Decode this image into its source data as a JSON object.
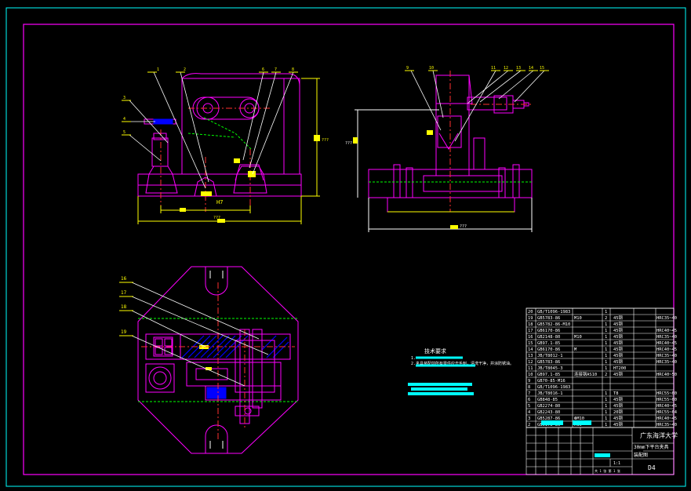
{
  "colors": {
    "background": "#000000",
    "outer_frame": "#00ffff",
    "drawing_border": "#ff00ff",
    "part_outline": "#ff00ff",
    "dimension": "#ffff00",
    "centerline": "#ff3030",
    "hidden_line": "#00ff00",
    "leader": "#ffffff",
    "hatch": "#0000ff",
    "title_text": "#ffffff",
    "highlight": "#00ffff"
  },
  "front_view": {
    "callouts": [
      "1",
      "2",
      "3",
      "4",
      "5",
      "6",
      "7",
      "8"
    ],
    "dim_width": "???",
    "dim_height": "???",
    "dim_fit": "H7"
  },
  "side_view": {
    "callouts": [
      "9",
      "10",
      "11",
      "12",
      "13",
      "14",
      "15"
    ],
    "dim_width": "???",
    "dim_height": "???"
  },
  "top_view": {
    "callouts": [
      "16",
      "17",
      "18",
      "19"
    ]
  },
  "tech_requirements": {
    "title": "技术要求",
    "line1": "1.",
    "line2": "2.夹具装配前所有零件应去毛刺，清洗干净，并涂防锈油。"
  },
  "parts_list": {
    "rows": [
      {
        "no": "20",
        "std": "GB/T1096-1983",
        "qty": "1",
        "mat": "",
        "remark": ""
      },
      {
        "no": "19",
        "std": "GB5783-86",
        "name": "M10",
        "qty": "2",
        "mat": "45钢",
        "remark": "HRC35~40"
      },
      {
        "no": "18",
        "std": "GB5782-86-M10",
        "qty": "1",
        "mat": "45钢",
        "remark": ""
      },
      {
        "no": "17",
        "std": "GB6170-86",
        "qty": "1",
        "mat": "45钢",
        "remark": "HRC40~45"
      },
      {
        "no": "16",
        "std": "GB2148-80",
        "name": "M10",
        "qty": "1",
        "mat": "45钢",
        "remark": "HRC35~40"
      },
      {
        "no": "15",
        "std": "GB97.1-85",
        "qty": "1",
        "mat": "45钢",
        "remark": "HRC40~45"
      },
      {
        "no": "14",
        "std": "GB6170-86",
        "name": "M",
        "qty": "1",
        "mat": "45钢",
        "remark": "HRC40~45"
      },
      {
        "no": "13",
        "std": "JB/T8012-1",
        "qty": "1",
        "mat": "45钢",
        "remark": "HRC35~40"
      },
      {
        "no": "12",
        "std": "GB5783-86",
        "qty": "1",
        "mat": "45钢",
        "remark": "HRC35~40"
      },
      {
        "no": "11",
        "std": "JB/T8045-3",
        "qty": "1",
        "mat": "HT200",
        "remark": ""
      },
      {
        "no": "10",
        "std": "GB97.1-85",
        "name": "连接钢AS10",
        "qty": "2",
        "mat": "45钢",
        "remark": "HRC40~50"
      },
      {
        "no": "9",
        "std": "GB70-85-M16",
        "name": "",
        "qty": "",
        "mat": "",
        "remark": ""
      },
      {
        "no": "8",
        "std": "GB/T1096-1983",
        "qty": "",
        "mat": "",
        "remark": ""
      },
      {
        "no": "7",
        "std": "JB/T8016-1",
        "qty": "1",
        "mat": "T8",
        "remark": "HRC55~60"
      },
      {
        "no": "6",
        "std": "GB848-85",
        "qty": "1",
        "mat": "45钢",
        "remark": "HRC55~60"
      },
      {
        "no": "5",
        "std": "GB2274-80",
        "qty": "1",
        "mat": "45钢",
        "remark": "HRC40~45"
      },
      {
        "no": "4",
        "std": "GB2243-80",
        "qty": "1",
        "mat": "20钢",
        "remark": "HRC55~64"
      },
      {
        "no": "3",
        "std": "GB5287-86",
        "name": "ФM10",
        "qty": "1",
        "mat": "45钢",
        "remark": "HRC40~45"
      },
      {
        "no": "2",
        "std": "GB6173-86",
        "name": "M10",
        "qty": "1",
        "mat": "45钢",
        "remark": "HRC35~40"
      }
    ]
  },
  "title_block": {
    "school": "广东海洋大学",
    "title": "30mm下平台夹具",
    "subtitle": "装配图",
    "sheet": "D4",
    "scale": "1:1",
    "footer": "共 1 张  第 1 张"
  }
}
